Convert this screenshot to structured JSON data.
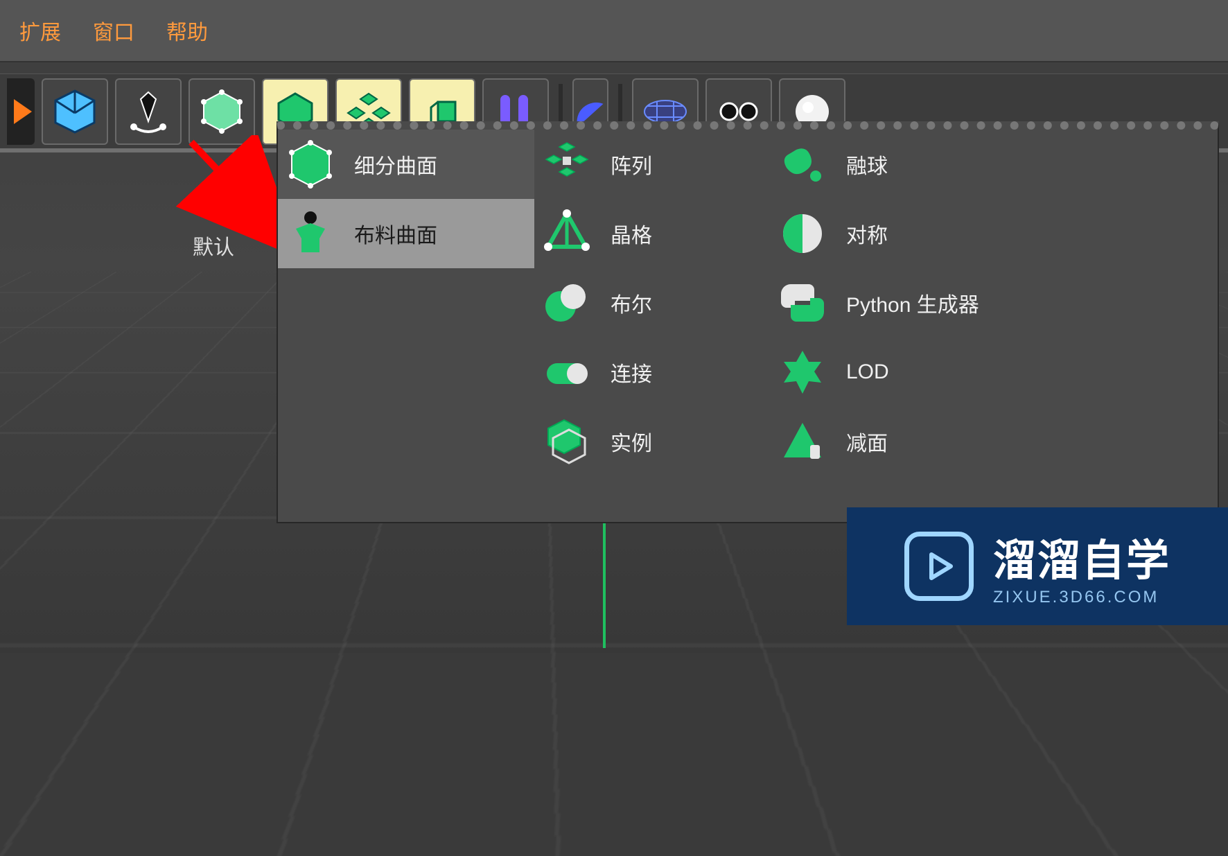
{
  "menu": {
    "items": [
      "扩展",
      "窗口",
      "帮助"
    ]
  },
  "toolbar": {
    "icons": [
      "orange-partial",
      "cube",
      "pen",
      "wireframe-cube",
      "subdiv-cube",
      "array-icon",
      "extrude-icon",
      "bars",
      "sphere-half",
      "grid",
      " eyes",
      "sphere-light"
    ],
    "sep_after": [
      7
    ]
  },
  "side_label": "默认",
  "popup": {
    "col1": [
      {
        "icon": "subdivision-icon",
        "label": "细分曲面",
        "state": "top"
      },
      {
        "icon": "cloth-icon",
        "label": "布料曲面",
        "state": "selected"
      }
    ],
    "col2": [
      {
        "icon": "array-obj-icon",
        "label": "阵列"
      },
      {
        "icon": "lattice-icon",
        "label": "晶格"
      },
      {
        "icon": "boole-icon",
        "label": "布尔"
      },
      {
        "icon": "connect-icon",
        "label": "连接"
      },
      {
        "icon": "instance-icon",
        "label": "实例"
      }
    ],
    "col3": [
      {
        "icon": "metaball-icon",
        "label": "融球"
      },
      {
        "icon": "symmetry-icon",
        "label": "对称"
      },
      {
        "icon": "python-icon",
        "label": "Python 生成器"
      },
      {
        "icon": "lod-icon",
        "label": "LOD"
      },
      {
        "icon": "reduce-icon",
        "label": "减面"
      }
    ]
  },
  "watermark": {
    "title": "溜溜自学",
    "url": "ZIXUE.3D66.COM"
  }
}
